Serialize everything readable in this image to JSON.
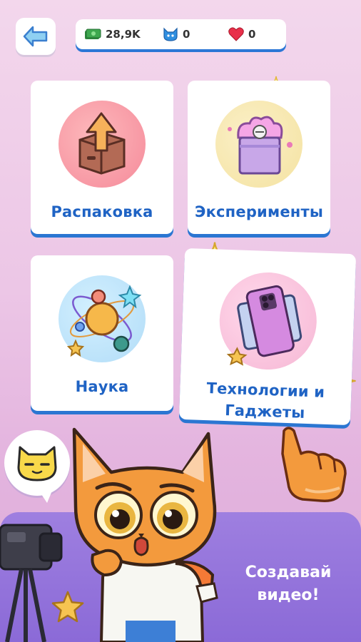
{
  "topbar": {
    "money": "28,9K",
    "cats": "0",
    "hearts": "0"
  },
  "categories": [
    {
      "label": "Распаковка",
      "icon": "unboxing-icon"
    },
    {
      "label": "Эксперименты",
      "icon": "experiment-icon"
    },
    {
      "label": "Наука",
      "icon": "science-icon"
    },
    {
      "label": "Технологии и Гаджеты",
      "label_line1": "Технологии и",
      "label_line2": "Гаджеты",
      "icon": "gadgets-icon"
    }
  ],
  "cta": {
    "line1": "Создавай",
    "line2": "видео!"
  },
  "colors": {
    "label_blue": "#1f63c4",
    "card_shadow": "#2b76d2",
    "banner": "#8b6ad7"
  }
}
